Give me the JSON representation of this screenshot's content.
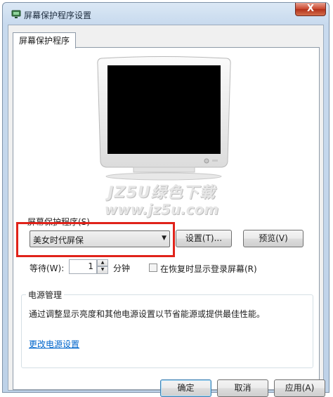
{
  "window": {
    "title": "屏幕保护程序设置",
    "close_label": "X"
  },
  "tabs": [
    {
      "label": "屏幕保护程序"
    }
  ],
  "watermark": {
    "line1": "JZ5U绿色下载",
    "line2": "www.jz5u.com"
  },
  "screensaver": {
    "group_label": "屏幕保护程序(S)",
    "selected": "美女时代屏保",
    "settings_button": "设置(T)...",
    "preview_button": "预览(V)",
    "wait_label": "等待(W):",
    "wait_value": "1",
    "minutes_label": "分钟",
    "resume_label": "在恢复时显示登录屏幕(R)",
    "resume_checked": false
  },
  "power": {
    "group_title": "电源管理",
    "description": "通过调整显示亮度和其他电源设置以节省能源或提供最佳性能。",
    "link": "更改电源设置"
  },
  "footer": {
    "ok": "确定",
    "cancel": "取消",
    "apply": "应用(A)"
  },
  "colors": {
    "highlight": "#e0231a",
    "link": "#0066cc",
    "screen": "#000000"
  }
}
